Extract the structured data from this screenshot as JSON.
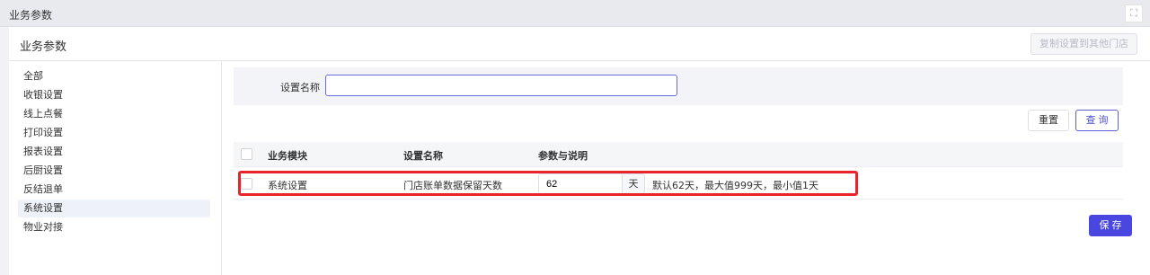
{
  "window": {
    "title": "业务参数",
    "expand_icon": "⛶"
  },
  "panel": {
    "title": "业务参数",
    "copy_button": "复制设置到其他门店"
  },
  "sidebar": {
    "items": [
      {
        "label": "全部"
      },
      {
        "label": "收银设置"
      },
      {
        "label": "线上点餐"
      },
      {
        "label": "打印设置"
      },
      {
        "label": "报表设置"
      },
      {
        "label": "后厨设置"
      },
      {
        "label": "反结退单"
      },
      {
        "label": "系统设置",
        "active": true
      },
      {
        "label": "物业对接"
      }
    ]
  },
  "filter": {
    "label": "设置名称",
    "value": "",
    "placeholder": "",
    "reset_button": "重置",
    "query_button": "查 询"
  },
  "table": {
    "columns": [
      "业务模块",
      "设置名称",
      "参数与说明"
    ],
    "rows": [
      {
        "module": "系统设置",
        "name": "门店账单数据保留天数",
        "value": "62",
        "unit": "天",
        "description": "默认62天，最大值999天，最小值1天"
      }
    ]
  },
  "save_button": "保 存",
  "colors": {
    "accent": "#4a47e0",
    "highlight": "#e8232b"
  }
}
